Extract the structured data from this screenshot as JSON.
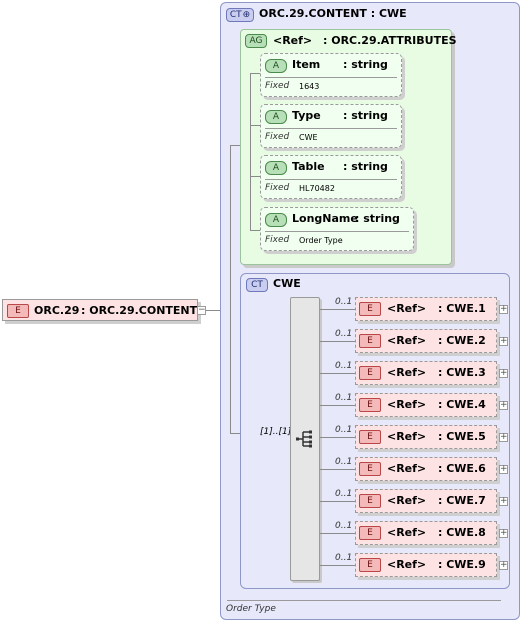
{
  "root": {
    "badge": "E",
    "name": "ORC.29",
    "type": ": ORC.29.CONTENT",
    "collapse_glyph": "−"
  },
  "content": {
    "badge": "CT",
    "title": "ORC.29.CONTENT : CWE",
    "footer": "Order Type",
    "attr_group": {
      "badge": "AG",
      "name": "<Ref>",
      "type": ": ORC.29.ATTRIBUTES",
      "attributes": [
        {
          "badge": "A",
          "name": "Item",
          "type": ": string",
          "fixed_label": "Fixed",
          "fixed": "1643"
        },
        {
          "badge": "A",
          "name": "Type",
          "type": ": string",
          "fixed_label": "Fixed",
          "fixed": "CWE"
        },
        {
          "badge": "A",
          "name": "Table",
          "type": ": string",
          "fixed_label": "Fixed",
          "fixed": "HL70482"
        },
        {
          "badge": "A",
          "name": "LongName",
          "type": ": string",
          "fixed_label": "Fixed",
          "fixed": "Order Type"
        }
      ]
    },
    "cwe": {
      "badge": "CT",
      "title": "CWE",
      "seq_cardinality": "[1]..[1]",
      "elements": [
        {
          "card": "0..1",
          "badge": "E",
          "name": "<Ref>",
          "type": ": CWE.1"
        },
        {
          "card": "0..1",
          "badge": "E",
          "name": "<Ref>",
          "type": ": CWE.2"
        },
        {
          "card": "0..1",
          "badge": "E",
          "name": "<Ref>",
          "type": ": CWE.3"
        },
        {
          "card": "0..1",
          "badge": "E",
          "name": "<Ref>",
          "type": ": CWE.4"
        },
        {
          "card": "0..1",
          "badge": "E",
          "name": "<Ref>",
          "type": ": CWE.5"
        },
        {
          "card": "0..1",
          "badge": "E",
          "name": "<Ref>",
          "type": ": CWE.6"
        },
        {
          "card": "0..1",
          "badge": "E",
          "name": "<Ref>",
          "type": ": CWE.7"
        },
        {
          "card": "0..1",
          "badge": "E",
          "name": "<Ref>",
          "type": ": CWE.8"
        },
        {
          "card": "0..1",
          "badge": "E",
          "name": "<Ref>",
          "type": ": CWE.9"
        }
      ]
    }
  }
}
